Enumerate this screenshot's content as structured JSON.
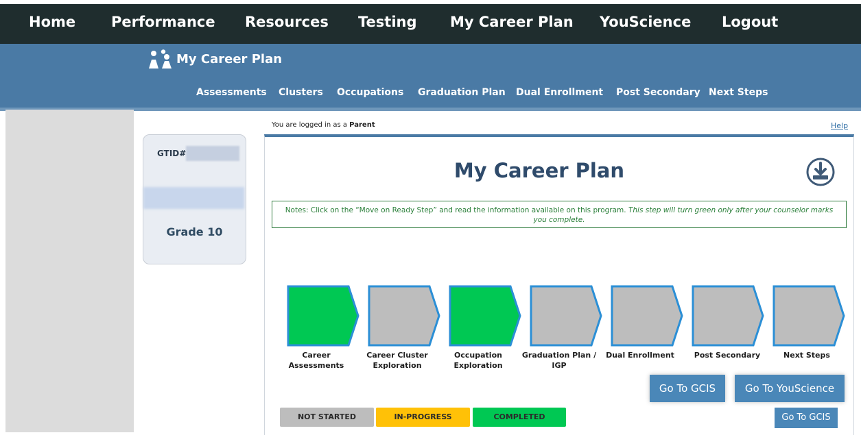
{
  "topnav": {
    "items": [
      "Home",
      "Performance",
      "Resources",
      "Testing",
      "My Career Plan",
      "YouScience",
      "Logout"
    ]
  },
  "header": {
    "title": "My Career Plan",
    "subnav": [
      "Assessments",
      "Clusters",
      "Occupations",
      "Graduation Plan",
      "Dual Enrollment",
      "Post Secondary",
      "Next Steps"
    ]
  },
  "profile": {
    "gtid_label": "GTID#",
    "grade": "Grade 10"
  },
  "session": {
    "logged_prefix": "You are logged in as a",
    "role": "Parent",
    "help": "Help"
  },
  "main": {
    "title": "My Career Plan",
    "notes_plain": "Notes: Click on the “Move on Ready Step” and read the information available on this program.",
    "notes_italic": "This step will turn green only after your counselor marks you complete."
  },
  "steps": [
    {
      "label": "Career Assessments",
      "status": "completed"
    },
    {
      "label": "Career Cluster Exploration",
      "status": "not-started"
    },
    {
      "label": "Occupation Exploration",
      "status": "completed"
    },
    {
      "label": "Graduation Plan / IGP",
      "status": "not-started"
    },
    {
      "label": "Dual Enrollment",
      "status": "not-started"
    },
    {
      "label": "Post Secondary",
      "status": "not-started"
    },
    {
      "label": "Next Steps",
      "status": "not-started"
    }
  ],
  "buttons": {
    "gcis": "Go To GCIS",
    "youscience": "Go To YouScience",
    "gcis_small": "Go To GCIS"
  },
  "legend": {
    "not_started": "NOT STARTED",
    "in_progress": "IN-PROGRESS",
    "completed": "COMPLETED"
  },
  "colors": {
    "completed": "#00c853",
    "not_started": "#bdbdbd",
    "in_progress": "#ffc107",
    "step_border": "#2b8fd6",
    "header_blue": "#4a7aa5",
    "topnav": "#1f2d2e"
  }
}
